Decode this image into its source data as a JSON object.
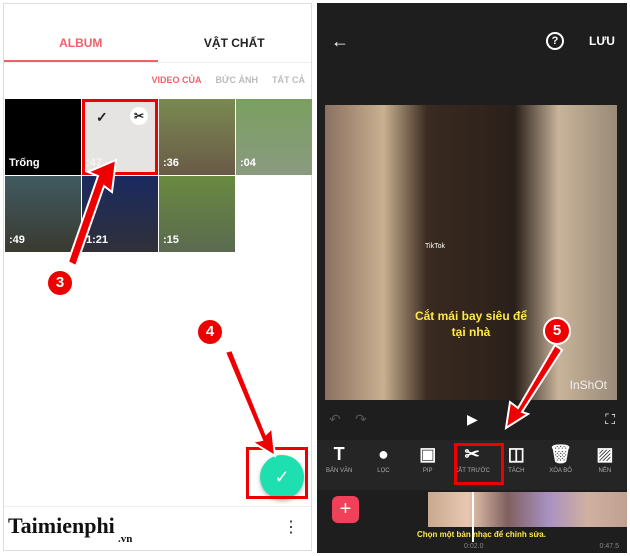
{
  "album": {
    "tabs": [
      "ALBUM",
      "VẬT CHẤT"
    ],
    "filters": [
      "VIDEO CỦA",
      "BỨC ẢNH",
      "TẤT CẢ"
    ],
    "items": [
      {
        "label": "Trống",
        "bg": "#000"
      },
      {
        "label": ":47",
        "bg": "#e6e4e2"
      },
      {
        "label": ":36",
        "bg": "#7a6a50"
      },
      {
        "label": ":04",
        "bg": "#8a9a70"
      },
      {
        "label": ":49",
        "bg": "#3a4a50"
      },
      {
        "label": "1:21",
        "bg": "#1a2040"
      },
      {
        "label": ":15",
        "bg": "#5a7040"
      }
    ],
    "check": "✓",
    "scissors": "✂",
    "fab": "✓",
    "menu": "⋮",
    "logo": "Taimienphi",
    "logo_tld": ".vn"
  },
  "editor": {
    "back": "←",
    "help": "?",
    "save": "LƯU",
    "caption1": "Cắt mái bay siêu để",
    "caption2": "tại nhà",
    "watermark": "InShOt",
    "tiktok": "TikTok",
    "play": "▶",
    "fullscreen": "⛶",
    "undo": "↶",
    "redo": "↷",
    "tools": [
      {
        "icon": "T",
        "label": "BẢN VĂN"
      },
      {
        "icon": "●",
        "label": "LỌC"
      },
      {
        "icon": "▣",
        "label": "PIP"
      },
      {
        "icon": "✂",
        "label": "CẮT TRƯỚC"
      },
      {
        "icon": "◫",
        "label": "TÁCH"
      },
      {
        "icon": "🗑",
        "label": "XÓA BỎ"
      },
      {
        "icon": "▨",
        "label": "NỀN"
      }
    ],
    "add": "+",
    "hint": "Chọn một bản nhạc để chỉnh sửa.",
    "time_current": "0:02.0",
    "time_total": "0:47.5"
  },
  "steps": [
    "3",
    "4",
    "5"
  ]
}
